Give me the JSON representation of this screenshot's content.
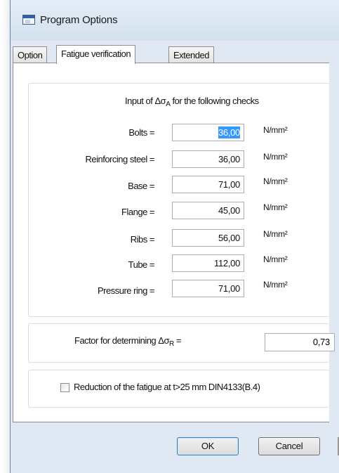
{
  "window": {
    "title": "Program Options"
  },
  "tabs": [
    {
      "label": "Option"
    },
    {
      "label": "Fatigue verification"
    },
    {
      "label": "Extended"
    }
  ],
  "fatigue": {
    "heading_prefix": "Input of Δσ",
    "heading_sub": "A",
    "heading_suffix": " for the following checks",
    "rows": [
      {
        "label": "Bolts =",
        "value": "36,00",
        "unit": "N/mm²"
      },
      {
        "label": "Reinforcing steel =",
        "value": "36,00",
        "unit": "N/mm²"
      },
      {
        "label": "Base =",
        "value": "71,00",
        "unit": "N/mm²"
      },
      {
        "label": "Flange =",
        "value": "45,00",
        "unit": "N/mm²"
      },
      {
        "label": "Ribs =",
        "value": "56,00",
        "unit": "N/mm²"
      },
      {
        "label": "Tube =",
        "value": "112,00",
        "unit": "N/mm²"
      },
      {
        "label": "Pressure ring =",
        "value": "71,00",
        "unit": "N/mm²"
      }
    ]
  },
  "factor": {
    "label_prefix": "Factor for determining  Δσ",
    "label_sub": "R",
    "label_suffix": "  =",
    "value": "0,73"
  },
  "reduction": {
    "label": "Reduction of the fatigue at t>25 mm DIN4133(B.4)",
    "checked": false
  },
  "buttons": {
    "ok": "OK",
    "cancel": "Cancel"
  }
}
